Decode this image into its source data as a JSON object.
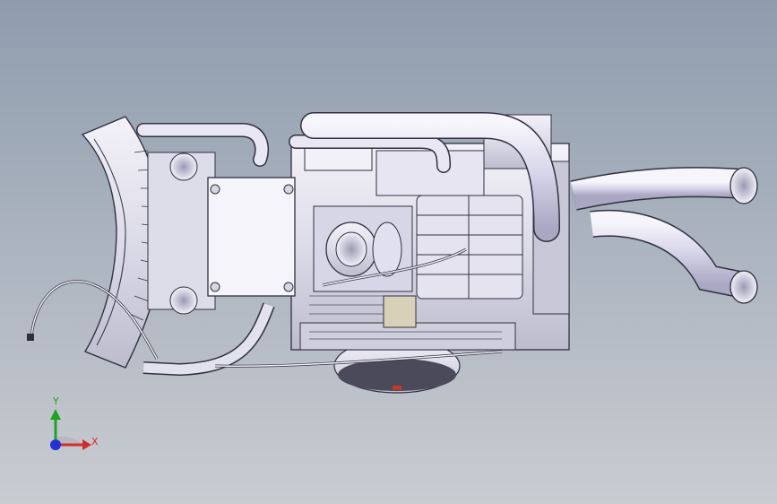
{
  "window": {
    "title": ""
  },
  "viewport": {
    "background_top": "#8f9cad",
    "background_bottom": "#c9ccd1",
    "model_fill": "#ecebf4",
    "model_edge": "#303040"
  },
  "triad": {
    "x_label": "X",
    "y_label": "Y",
    "x_color": "#d42b2b",
    "y_color": "#1ea31e",
    "z_color": "#2431d8"
  },
  "model": {
    "icon": "engine-assembly-icon",
    "parts": [
      "cooling-fan-shroud",
      "engine-block",
      "intake-throttle",
      "exhaust-pipe",
      "wiring-harness",
      "flywheel"
    ]
  }
}
